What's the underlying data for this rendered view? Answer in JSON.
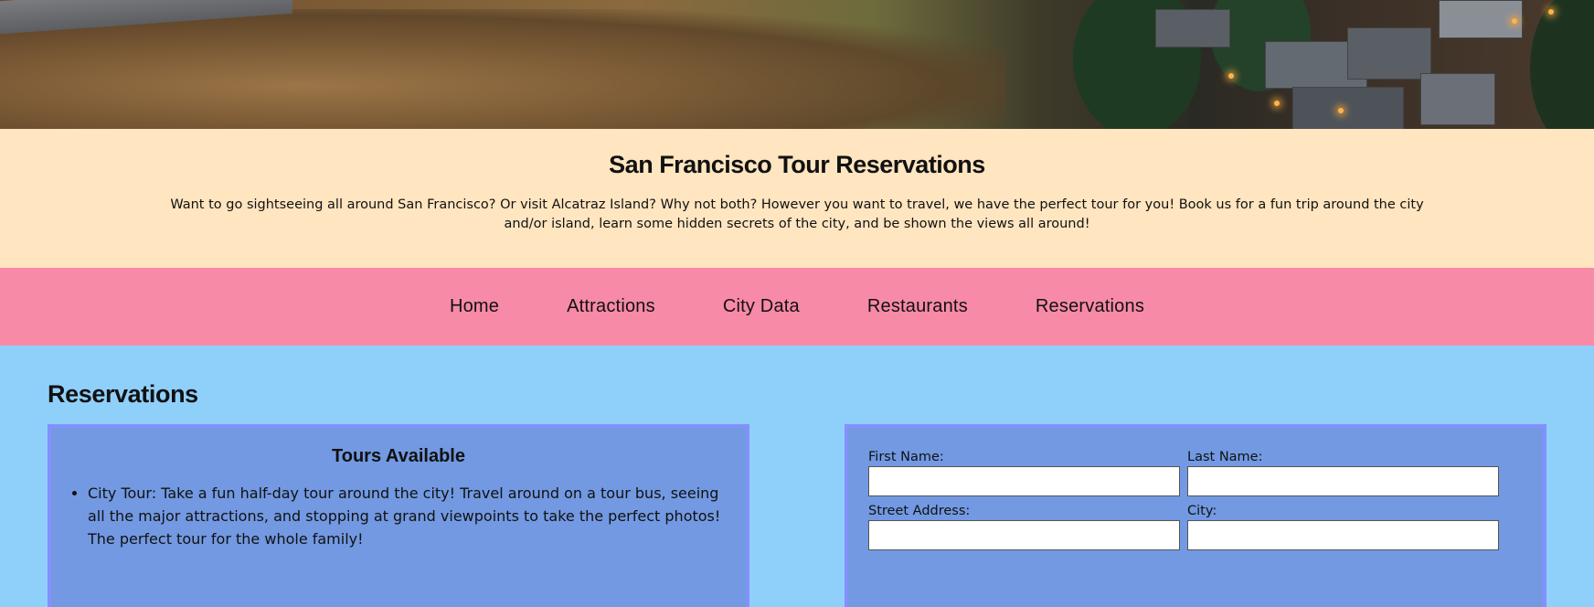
{
  "banner": {
    "title": "San Francisco Tour Reservations",
    "description": "Want to go sightseeing all around San Francisco? Or visit Alcatraz Island? Why not both? However you want to travel, we have the perfect tour for you! Book us for a fun trip around the city and/or island, learn some hidden secrets of the city, and be shown the views all around!"
  },
  "nav": {
    "items": [
      {
        "label": "Home"
      },
      {
        "label": "Attractions"
      },
      {
        "label": "City Data"
      },
      {
        "label": "Restaurants"
      },
      {
        "label": "Reservations"
      }
    ]
  },
  "main": {
    "heading": "Reservations",
    "tours": {
      "title": "Tours Available",
      "items": [
        {
          "text": "City Tour: Take a fun half-day tour around the city! Travel around on a tour bus, seeing all the major attractions, and stopping at grand viewpoints to take the perfect photos! The perfect tour for the whole family!"
        }
      ]
    },
    "form": {
      "first_name_label": "First Name:",
      "first_name_value": "",
      "last_name_label": "Last Name:",
      "last_name_value": "",
      "street_label": "Street Address:",
      "street_value": "",
      "city_label": "City:",
      "city_value": ""
    }
  },
  "colors": {
    "banner_bg": "#ffe5c0",
    "nav_bg": "#f78aa7",
    "page_bg": "#8fd0fb",
    "panel_bg": "#7299e2",
    "panel_border": "#8490fc"
  }
}
